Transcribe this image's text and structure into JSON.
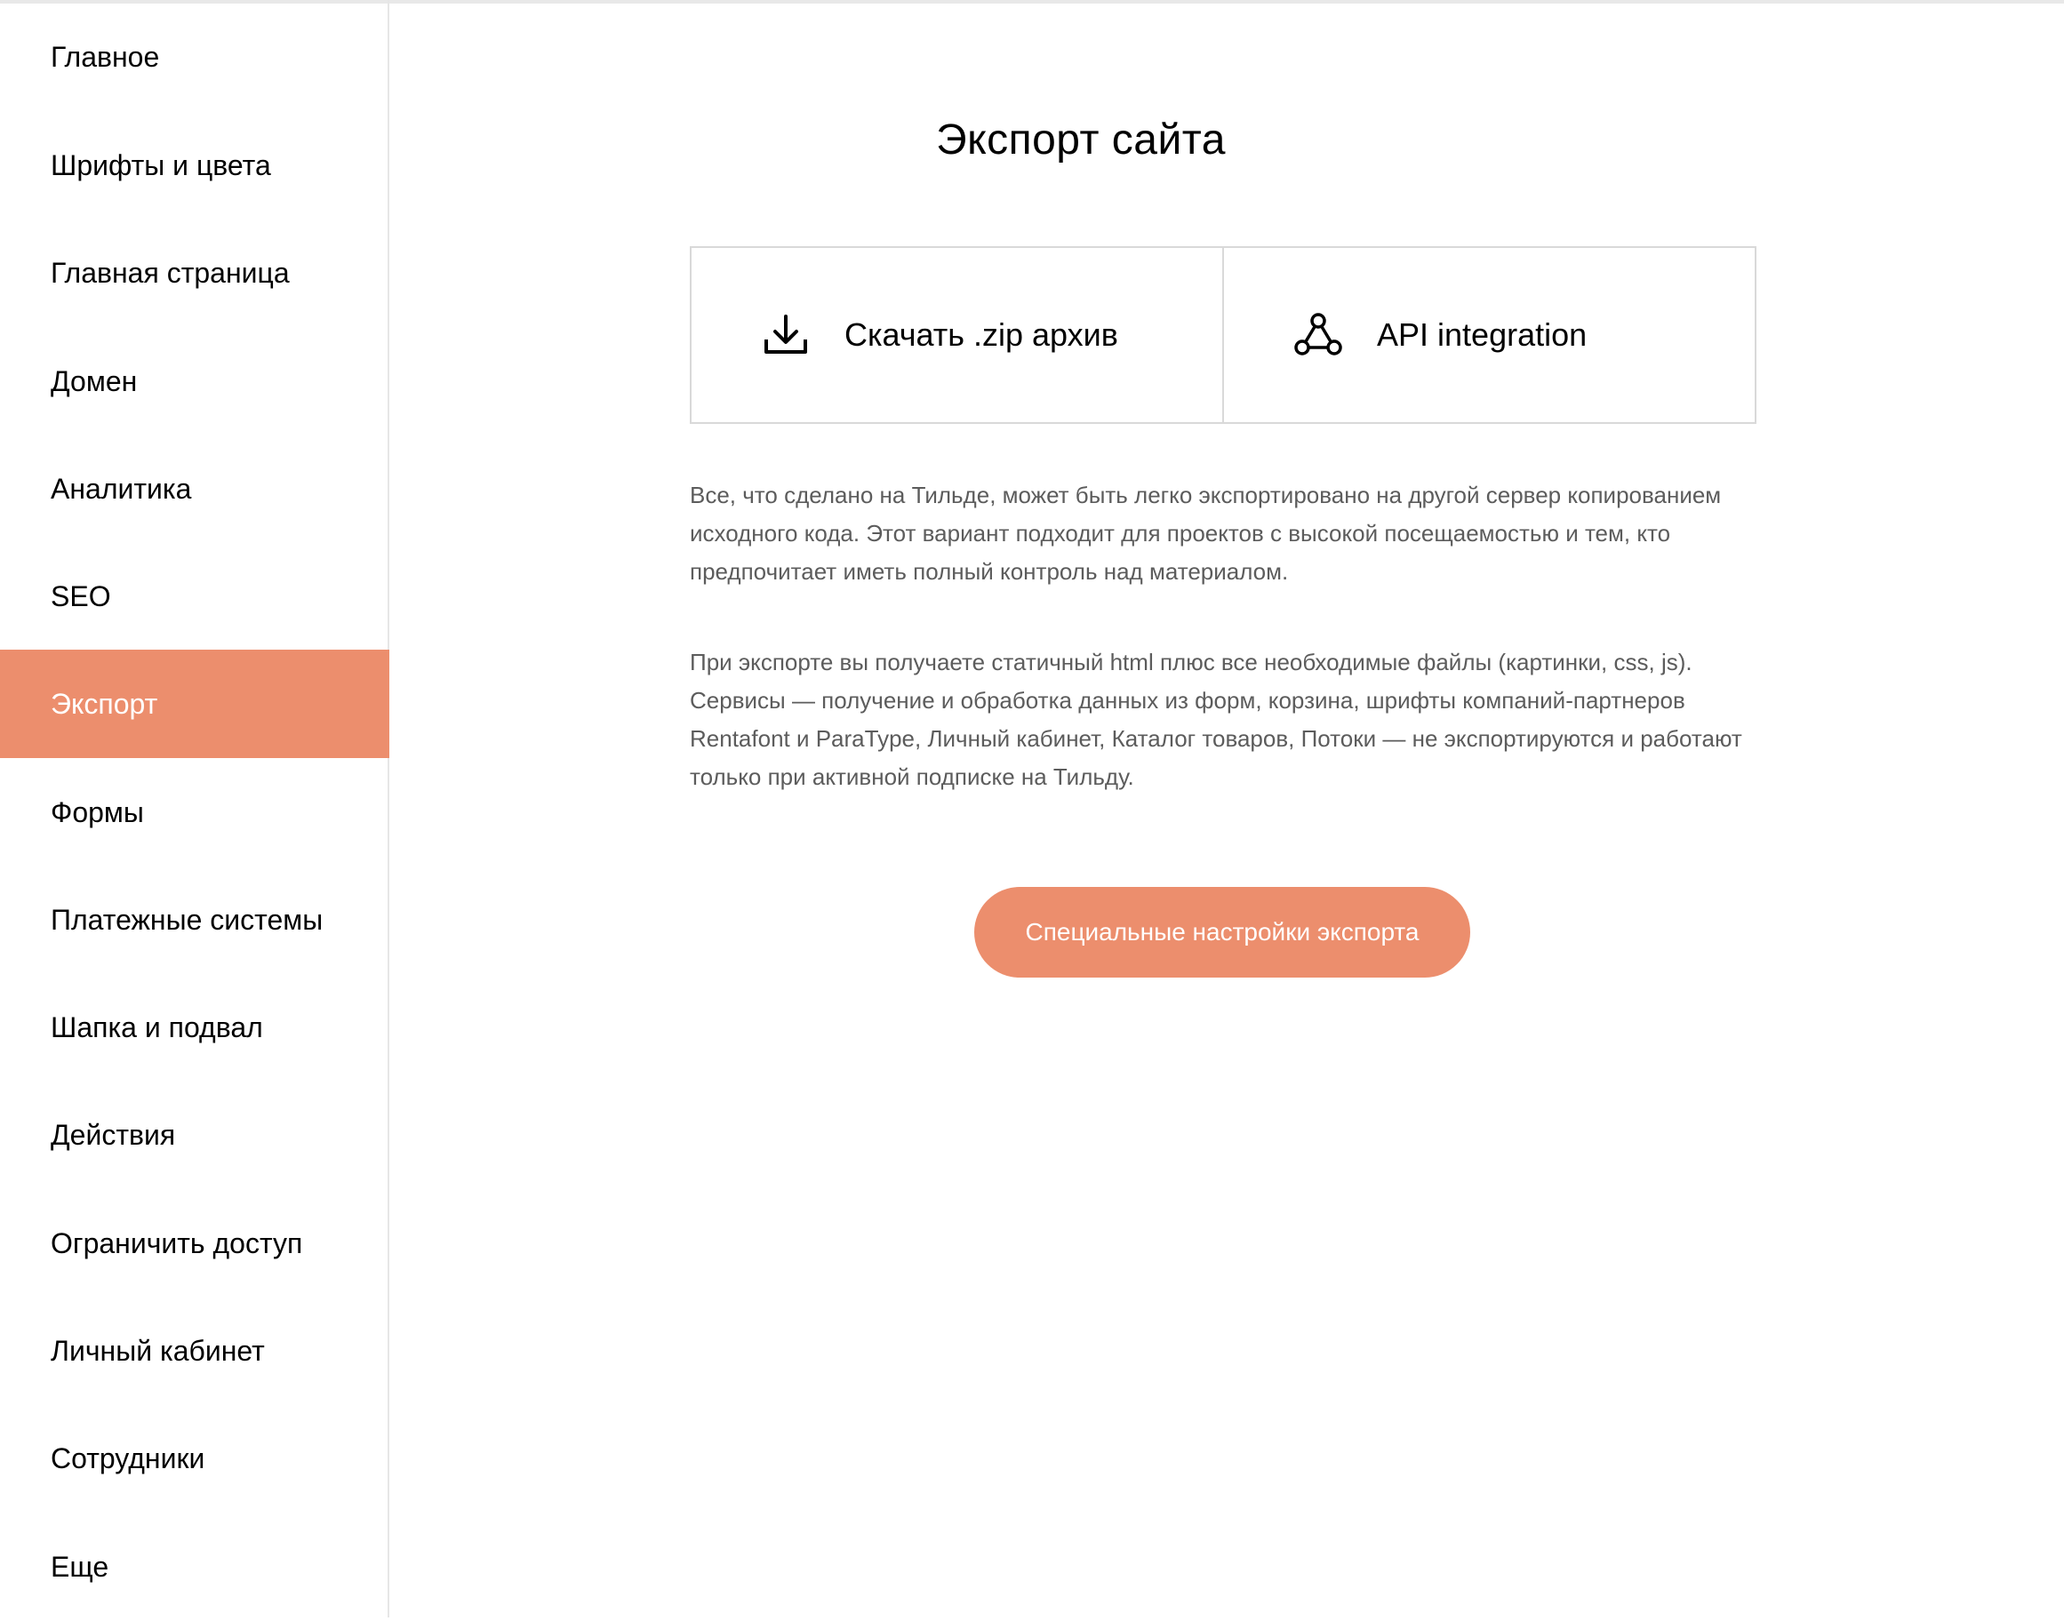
{
  "sidebar": {
    "items": [
      {
        "label": "Главное"
      },
      {
        "label": "Шрифты и цвета"
      },
      {
        "label": "Главная страница"
      },
      {
        "label": "Домен"
      },
      {
        "label": "Аналитика"
      },
      {
        "label": "SEO"
      },
      {
        "label": "Экспорт"
      },
      {
        "label": "Формы"
      },
      {
        "label": "Платежные системы"
      },
      {
        "label": "Шапка и подвал"
      },
      {
        "label": "Действия"
      },
      {
        "label": "Ограничить доступ"
      },
      {
        "label": "Личный кабинет"
      },
      {
        "label": "Сотрудники"
      },
      {
        "label": "Еще"
      }
    ],
    "active_label": "Экспорт"
  },
  "main": {
    "title": "Экспорт сайта",
    "options": {
      "zip": {
        "label": "Скачать .zip архив",
        "icon": "download-icon"
      },
      "api": {
        "label": "API integration",
        "icon": "api-integration-icon"
      }
    },
    "description_1": "Все, что сделано на Тильде, может быть легко экспортировано на другой сервер копированием исходного кода. Этот вариант подходит для проектов с высокой посещаемостью и тем, кто предпочитает иметь полный контроль над материалом.",
    "description_2": "При экспорте вы получаете статичный html плюс все необходимые файлы (картинки, css, js). Сервисы — получение и обработка данных из форм, корзина, шрифты компаний-партнеров Rentafont и ParaType, Личный кабинет, Каталог товаров, Потоки — не экспортируются и работают только при активной подписке на Тильду.",
    "special_button": "Специальные настройки экспорта"
  },
  "colors": {
    "accent": "#ec8e6d",
    "text": "#000000",
    "muted_text": "#5c5c5c",
    "border": "#d9d9d9"
  }
}
